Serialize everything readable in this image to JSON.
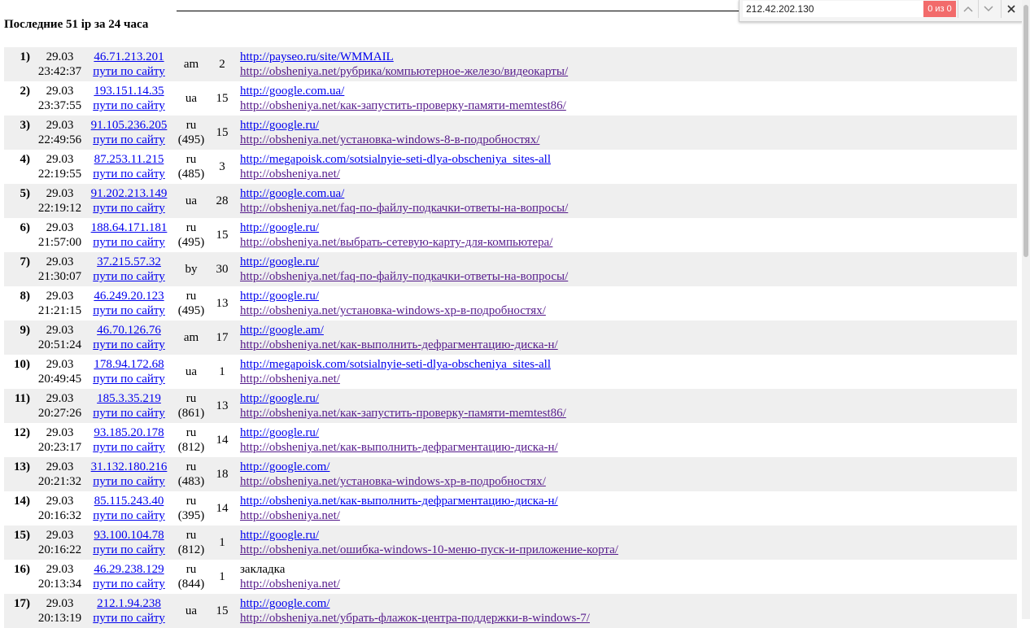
{
  "page_title": "Последние 51 ip за 24 часа",
  "find_bar": {
    "value": "212.42.202.130",
    "match_count": "0 из 0",
    "prev_icon": "chevron-up-icon",
    "next_icon": "chevron-down-icon",
    "close_icon": "close-icon"
  },
  "colors": {
    "row_shade": "#efefef",
    "link": "#0000ee",
    "visited_link": "#551a8b",
    "find_no_match": "#f26b6b"
  },
  "rows": [
    {
      "num": "1)",
      "date": "29.03",
      "time": "23:42:37",
      "ip": "46.71.213.201",
      "paths": "пути по сайту",
      "country": "am",
      "code": "",
      "count": "2",
      "ref": "http://payseo.ru/site/WMMAIL",
      "page": "http://obsheniya.net/рубрика/компьютерное-железо/видеокарты/"
    },
    {
      "num": "2)",
      "date": "29.03",
      "time": "23:37:55",
      "ip": "193.151.14.35",
      "paths": "пути по сайту",
      "country": "ua",
      "code": "",
      "count": "15",
      "ref": "http://google.com.ua/",
      "page": "http://obsheniya.net/как-запустить-проверку-памяти-memtest86/"
    },
    {
      "num": "3)",
      "date": "29.03",
      "time": "22:49:56",
      "ip": "91.105.236.205",
      "paths": "пути по сайту",
      "country": "ru",
      "code": "(495)",
      "count": "15",
      "ref": "http://google.ru/",
      "page": "http://obsheniya.net/установка-windows-8-в-подробностях/"
    },
    {
      "num": "4)",
      "date": "29.03",
      "time": "22:19:55",
      "ip": "87.253.11.215",
      "paths": "пути по сайту",
      "country": "ru",
      "code": "(485)",
      "count": "3",
      "ref": "http://megapoisk.com/sotsialnyie-seti-dlya-obscheniya_sites-all",
      "page": "http://obsheniya.net/"
    },
    {
      "num": "5)",
      "date": "29.03",
      "time": "22:19:12",
      "ip": "91.202.213.149",
      "paths": "пути по сайту",
      "country": "ua",
      "code": "",
      "count": "28",
      "ref": "http://google.com.ua/",
      "page": "http://obsheniya.net/faq-по-файлу-подкачки-ответы-на-вопросы/"
    },
    {
      "num": "6)",
      "date": "29.03",
      "time": "21:57:00",
      "ip": "188.64.171.181",
      "paths": "пути по сайту",
      "country": "ru",
      "code": "(495)",
      "count": "15",
      "ref": "http://google.ru/",
      "page": "http://obsheniya.net/выбрать-сетевую-карту-для-компьютера/"
    },
    {
      "num": "7)",
      "date": "29.03",
      "time": "21:30:07",
      "ip": "37.215.57.32",
      "paths": "пути по сайту",
      "country": "by",
      "code": "",
      "count": "30",
      "ref": "http://google.ru/",
      "page": "http://obsheniya.net/faq-по-файлу-подкачки-ответы-на-вопросы/"
    },
    {
      "num": "8)",
      "date": "29.03",
      "time": "21:21:15",
      "ip": "46.249.20.123",
      "paths": "пути по сайту",
      "country": "ru",
      "code": "(495)",
      "count": "13",
      "ref": "http://google.ru/",
      "page": "http://obsheniya.net/установка-windows-xp-в-подробностях/"
    },
    {
      "num": "9)",
      "date": "29.03",
      "time": "20:51:24",
      "ip": "46.70.126.76",
      "paths": "пути по сайту",
      "country": "am",
      "code": "",
      "count": "17",
      "ref": "http://google.am/",
      "page": "http://obsheniya.net/как-выполнить-дефрагментацию-диска-н/"
    },
    {
      "num": "10)",
      "date": "29.03",
      "time": "20:49:45",
      "ip": "178.94.172.68",
      "paths": "пути по сайту",
      "country": "ua",
      "code": "",
      "count": "1",
      "ref": "http://megapoisk.com/sotsialnyie-seti-dlya-obscheniya_sites-all",
      "page": "http://obsheniya.net/"
    },
    {
      "num": "11)",
      "date": "29.03",
      "time": "20:27:26",
      "ip": "185.3.35.219",
      "paths": "пути по сайту",
      "country": "ru",
      "code": "(861)",
      "count": "13",
      "ref": "http://google.ru/",
      "page": "http://obsheniya.net/как-запустить-проверку-памяти-memtest86/"
    },
    {
      "num": "12)",
      "date": "29.03",
      "time": "20:23:17",
      "ip": "93.185.20.178",
      "paths": "пути по сайту",
      "country": "ru",
      "code": "(812)",
      "count": "14",
      "ref": "http://google.ru/",
      "page": "http://obsheniya.net/как-выполнить-дефрагментацию-диска-н/"
    },
    {
      "num": "13)",
      "date": "29.03",
      "time": "20:21:32",
      "ip": "31.132.180.216",
      "paths": "пути по сайту",
      "country": "ru",
      "code": "(483)",
      "count": "18",
      "ref": "http://google.com/",
      "page": "http://obsheniya.net/установка-windows-xp-в-подробностях/"
    },
    {
      "num": "14)",
      "date": "29.03",
      "time": "20:16:32",
      "ip": "85.115.243.40",
      "paths": "пути по сайту",
      "country": "ru",
      "code": "(395)",
      "count": "14",
      "ref": "http://obsheniya.net/как-выполнить-дефрагментацию-диска-н/",
      "page": "http://obsheniya.net/"
    },
    {
      "num": "15)",
      "date": "29.03",
      "time": "20:16:22",
      "ip": "93.100.104.78",
      "paths": "пути по сайту",
      "country": "ru",
      "code": "(812)",
      "count": "1",
      "ref": "http://google.ru/",
      "page": "http://obsheniya.net/ошибка-windows-10-меню-пуск-и-приложение-корта/"
    },
    {
      "num": "16)",
      "date": "29.03",
      "time": "20:13:34",
      "ip": "46.29.238.129",
      "paths": "пути по сайту",
      "country": "ru",
      "code": "(844)",
      "count": "1",
      "ref": "закладка",
      "page": "http://obsheniya.net/"
    },
    {
      "num": "17)",
      "date": "29.03",
      "time": "20:13:19",
      "ip": "212.1.94.238",
      "paths": "пути по сайту",
      "country": "ua",
      "code": "",
      "count": "15",
      "ref": "http://google.com/",
      "page": "http://obsheniya.net/убрать-флажок-центра-поддержки-в-windows-7/"
    }
  ]
}
